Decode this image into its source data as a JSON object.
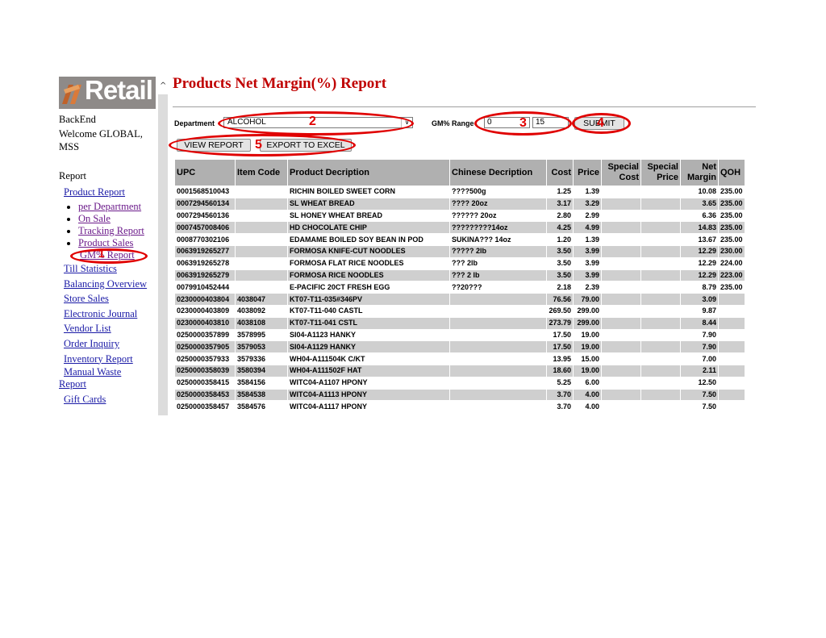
{
  "sidebar": {
    "logo_text": "Retail",
    "backend": "BackEnd",
    "welcome": "Welcome GLOBAL, MSS",
    "report_heading": "Report",
    "product_report": "Product Report",
    "sub_items": [
      "per Department",
      "On Sale",
      "Tracking Report",
      "Product Sales",
      "GM% Report"
    ],
    "nav_items": [
      "Till Statistics",
      "Balancing Overview",
      "Store Sales",
      "Electronic Journal",
      "Vendor List",
      "Order Inquiry",
      "Inventory Report",
      "Manual Waste"
    ],
    "report_link": "Report",
    "gift_cards": "Gift Cards"
  },
  "page": {
    "title": "Products Net Margin(%) Report"
  },
  "form": {
    "department_label": "Department",
    "department_value": "ALCOHOL",
    "gm_range_label": "GM% Range",
    "gm_min": "0",
    "gm_max": "15",
    "submit_label": "SUBMIT",
    "view_report_label": "VIEW REPORT",
    "export_label": "EXPORT TO EXCEL"
  },
  "annotations": [
    "1",
    "2",
    "3",
    "4",
    "5"
  ],
  "colors": {
    "title": "#c00000",
    "annotation": "#e00000",
    "header_bg": "#b0b0b0",
    "alt_row_bg": "#cfcfcf"
  },
  "table": {
    "headers": [
      "UPC",
      "Item Code",
      "Product Decription",
      "Chinese Decription",
      "Cost",
      "Price",
      "Special Cost",
      "Special Price",
      "Net Margin",
      "QOH"
    ],
    "rows": [
      [
        "0001568510043",
        "",
        "RICHIN BOILED SWEET CORN",
        "????500g",
        "1.25",
        "1.39",
        "",
        "",
        "10.08",
        "235.00"
      ],
      [
        "0007294560134",
        "",
        "SL WHEAT BREAD",
        "???? 20oz",
        "3.17",
        "3.29",
        "",
        "",
        "3.65",
        "235.00"
      ],
      [
        "0007294560136",
        "",
        "SL HONEY WHEAT BREAD",
        "?????? 20oz",
        "2.80",
        "2.99",
        "",
        "",
        "6.36",
        "235.00"
      ],
      [
        "0007457008406",
        "",
        "HD CHOCOLATE CHIP",
        "?????????14oz",
        "4.25",
        "4.99",
        "",
        "",
        "14.83",
        "235.00"
      ],
      [
        "0008770302106",
        "",
        "EDAMAME BOILED SOY BEAN IN POD",
        "SUKINA??? 14oz",
        "1.20",
        "1.39",
        "",
        "",
        "13.67",
        "235.00"
      ],
      [
        "0063919265277",
        "",
        "FORMOSA KNIFE-CUT NOODLES",
        "????? 2lb",
        "3.50",
        "3.99",
        "",
        "",
        "12.29",
        "230.00"
      ],
      [
        "0063919265278",
        "",
        "FORMOSA FLAT RICE NOODLES",
        "??? 2lb",
        "3.50",
        "3.99",
        "",
        "",
        "12.29",
        "224.00"
      ],
      [
        "0063919265279",
        "",
        "FORMOSA RICE NOODLES",
        "??? 2 lb",
        "3.50",
        "3.99",
        "",
        "",
        "12.29",
        "223.00"
      ],
      [
        "0079910452444",
        "",
        "E-PACIFIC 20CT FRESH EGG",
        "??20???",
        "2.18",
        "2.39",
        "",
        "",
        "8.79",
        "235.00"
      ],
      [
        "0230000403804",
        "4038047",
        "KT07-T11-035#346PV",
        "",
        "76.56",
        "79.00",
        "",
        "",
        "3.09",
        ""
      ],
      [
        "0230000403809",
        "4038092",
        "KT07-T11-040 CASTL",
        "",
        "269.50",
        "299.00",
        "",
        "",
        "9.87",
        ""
      ],
      [
        "0230000403810",
        "4038108",
        "KT07-T11-041 CSTL",
        "",
        "273.79",
        "299.00",
        "",
        "",
        "8.44",
        ""
      ],
      [
        "0250000357899",
        "3578995",
        "SI04-A1123 HANKY",
        "",
        "17.50",
        "19.00",
        "",
        "",
        "7.90",
        ""
      ],
      [
        "0250000357905",
        "3579053",
        "SI04-A1129 HANKY",
        "",
        "17.50",
        "19.00",
        "",
        "",
        "7.90",
        ""
      ],
      [
        "0250000357933",
        "3579336",
        "WH04-A111504K C/KT",
        "",
        "13.95",
        "15.00",
        "",
        "",
        "7.00",
        ""
      ],
      [
        "0250000358039",
        "3580394",
        "WH04-A111502F HAT",
        "",
        "18.60",
        "19.00",
        "",
        "",
        "2.11",
        ""
      ],
      [
        "0250000358415",
        "3584156",
        "WITC04-A1107 HPONY",
        "",
        "5.25",
        "6.00",
        "",
        "",
        "12.50",
        ""
      ],
      [
        "0250000358453",
        "3584538",
        "WITC04-A1113 HPONY",
        "",
        "3.70",
        "4.00",
        "",
        "",
        "7.50",
        ""
      ],
      [
        "0250000358457",
        "3584576",
        "WITC04-A1117 HPONY",
        "",
        "3.70",
        "4.00",
        "",
        "",
        "7.50",
        ""
      ]
    ]
  }
}
